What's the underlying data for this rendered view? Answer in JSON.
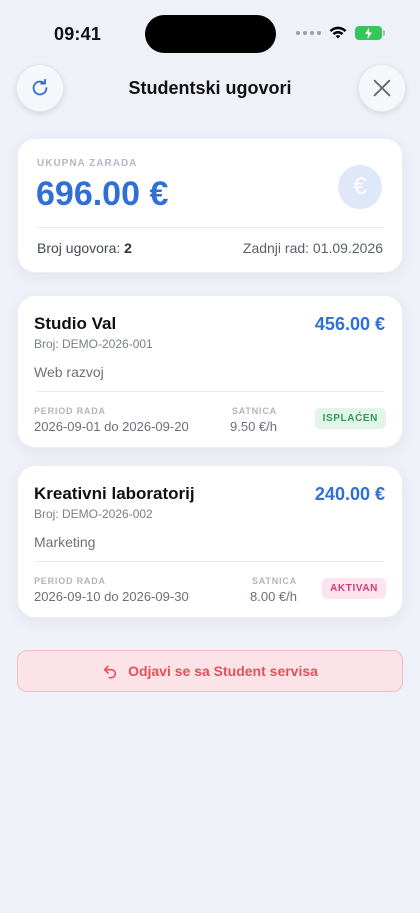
{
  "status_bar": {
    "time": "09:41"
  },
  "header": {
    "title": "Studentski ugovori"
  },
  "summary": {
    "label": "UKUPNA ZARADA",
    "amount": "696.00 €",
    "currency_icon": "€",
    "count_label": "Broj ugovora:",
    "count_value": "2",
    "last_work": "Zadnji rad: 01.09.2026"
  },
  "contracts": [
    {
      "name": "Studio Val",
      "amount": "456.00 €",
      "number": "Broj: DEMO-2026-001",
      "category": "Web razvoj",
      "period_label": "PERIOD RADA",
      "period": "2026-09-01 do 2026-09-20",
      "rate_label": "SATNICA",
      "rate": "9.50 €/h",
      "status": "ISPLAĆEN"
    },
    {
      "name": "Kreativni laboratorij",
      "amount": "240.00 €",
      "number": "Broj: DEMO-2026-002",
      "category": "Marketing",
      "period_label": "PERIOD RADA",
      "period": "2026-09-10 do 2026-09-30",
      "rate_label": "SATNICA",
      "rate": "8.00 €/h",
      "status": "AKTIVAN"
    }
  ],
  "logout": {
    "label": "Odjavi se sa Student servisa"
  },
  "colors": {
    "accent": "#2f6fd6",
    "paid": "#2e9b56",
    "active": "#d33a7a",
    "danger": "#e0515b"
  },
  "icons": [
    "refresh-icon",
    "close-icon",
    "euro-icon",
    "undo-arrow-icon",
    "wifi-icon",
    "battery-icon",
    "signal-icon"
  ]
}
